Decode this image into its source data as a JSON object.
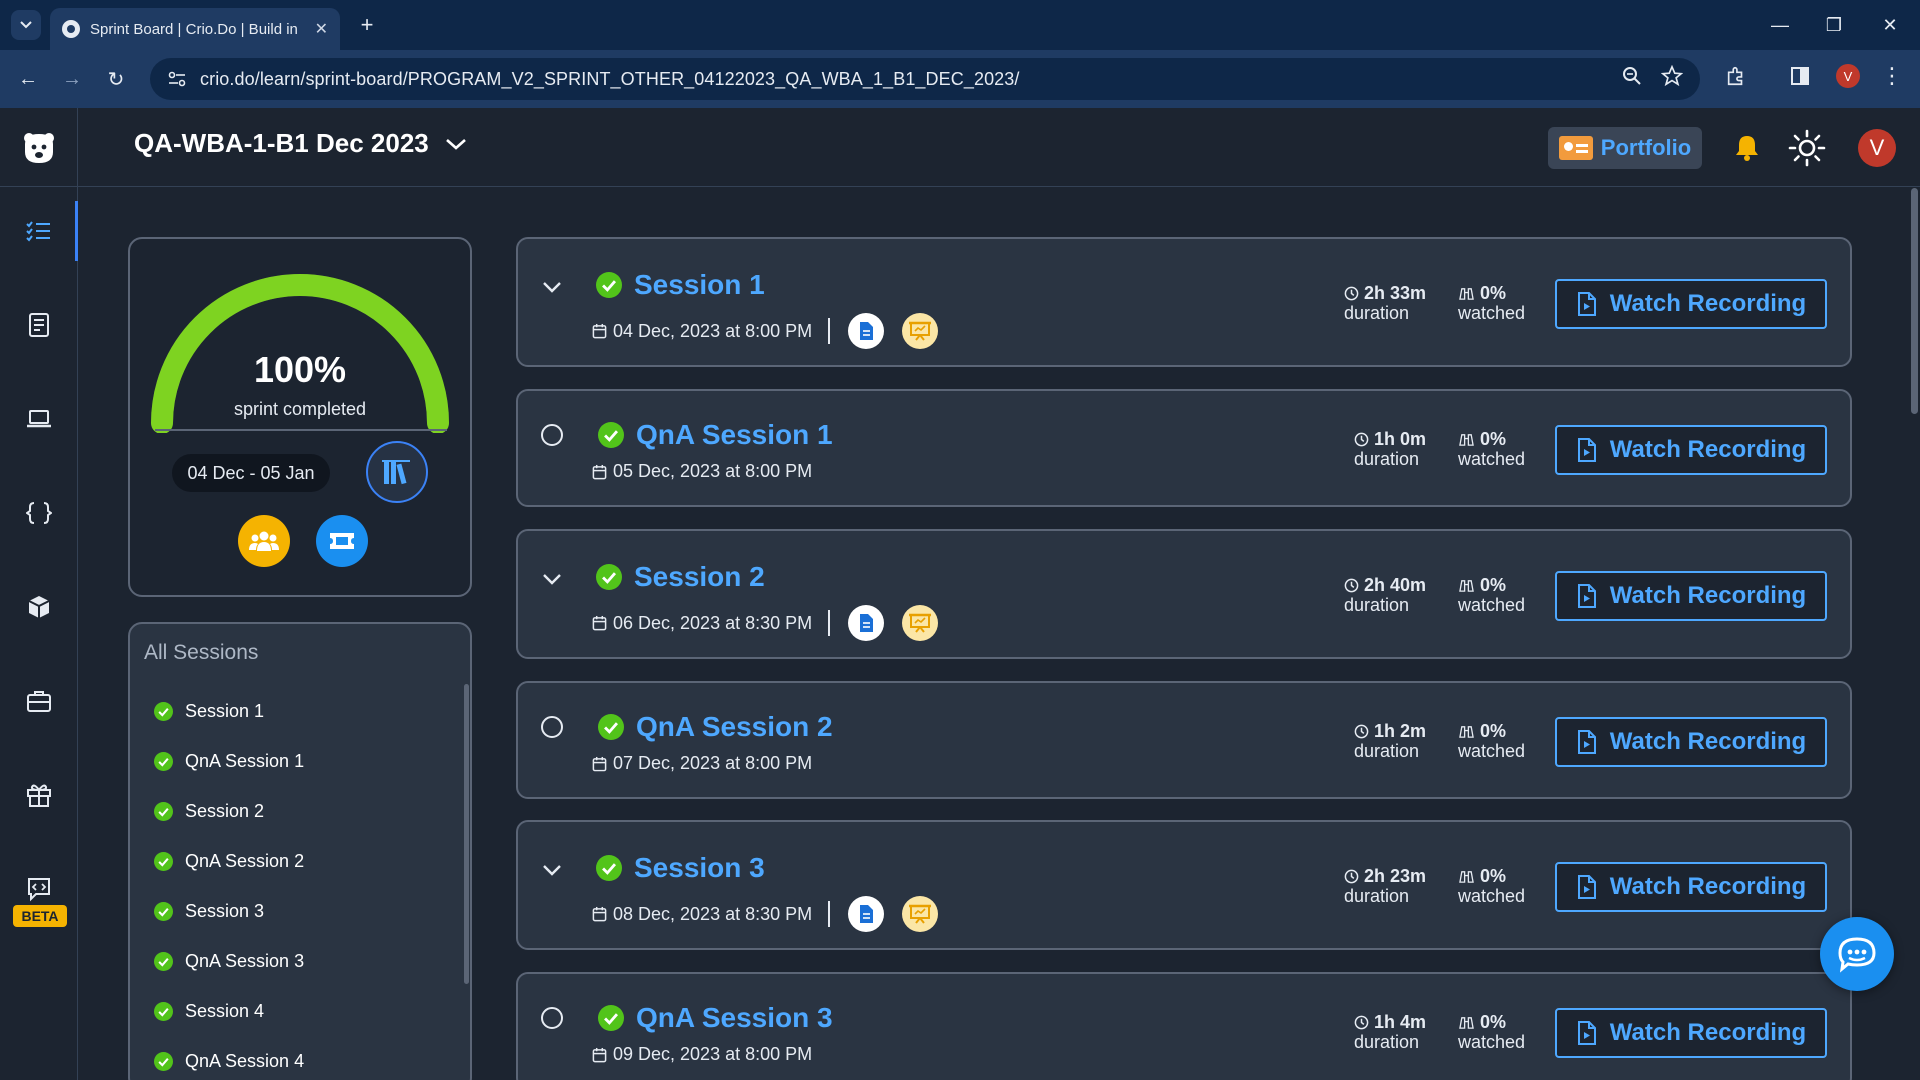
{
  "browser": {
    "tab_title": "Sprint Board | Crio.Do | Build in",
    "url": "crio.do/learn/sprint-board/PROGRAM_V2_SPRINT_OTHER_04122023_QA_WBA_1_B1_DEC_2023/",
    "profile_initial": "V"
  },
  "header": {
    "sprint_name": "QA-WBA-1-B1 Dec 2023",
    "portfolio_label": "Portfolio",
    "avatar_initial": "V"
  },
  "sidebar": {
    "beta_label": "BETA",
    "icons": [
      "list-check-icon",
      "notebook-icon",
      "laptop-icon",
      "code-braces-icon",
      "cube-icon",
      "briefcase-icon",
      "gift-icon",
      "code-chat-icon"
    ]
  },
  "progress": {
    "percent_text": "100%",
    "percent_value": 1.0,
    "subtitle": "sprint completed",
    "date_range": "04 Dec - 05 Jan"
  },
  "all_sessions": {
    "heading": "All Sessions",
    "items": [
      "Session 1",
      "QnA Session 1",
      "Session 2",
      "QnA Session 2",
      "Session 3",
      "QnA Session 3",
      "Session 4",
      "QnA Session 4"
    ]
  },
  "sessions": [
    {
      "title": "Session 1",
      "date": "04 Dec, 2023 at 8:00 PM",
      "duration": "2h 33m",
      "duration_label": "duration",
      "watched": "0%",
      "watched_label": "watched",
      "button": "Watch Recording",
      "kind": "session"
    },
    {
      "title": "QnA Session 1",
      "date": "05 Dec, 2023 at 8:00 PM",
      "duration": "1h 0m",
      "duration_label": "duration",
      "watched": "0%",
      "watched_label": "watched",
      "button": "Watch Recording",
      "kind": "qna"
    },
    {
      "title": "Session 2",
      "date": "06 Dec, 2023 at 8:30 PM",
      "duration": "2h 40m",
      "duration_label": "duration",
      "watched": "0%",
      "watched_label": "watched",
      "button": "Watch Recording",
      "kind": "session"
    },
    {
      "title": "QnA Session 2",
      "date": "07 Dec, 2023 at 8:00 PM",
      "duration": "1h 2m",
      "duration_label": "duration",
      "watched": "0%",
      "watched_label": "watched",
      "button": "Watch Recording",
      "kind": "qna"
    },
    {
      "title": "Session 3",
      "date": "08 Dec, 2023 at 8:30 PM",
      "duration": "2h 23m",
      "duration_label": "duration",
      "watched": "0%",
      "watched_label": "watched",
      "button": "Watch Recording",
      "kind": "session"
    },
    {
      "title": "QnA Session 3",
      "date": "09 Dec, 2023 at 8:00 PM",
      "duration": "1h 4m",
      "duration_label": "duration",
      "watched": "0%",
      "watched_label": "watched",
      "button": "Watch Recording",
      "kind": "qna"
    }
  ],
  "colors": {
    "accent_blue": "#4ea8ff",
    "success_green": "#52c41a",
    "gauge_green": "#7ed321",
    "warning_yellow": "#f5b301",
    "background": "#1c2430",
    "card": "#2a3442"
  }
}
